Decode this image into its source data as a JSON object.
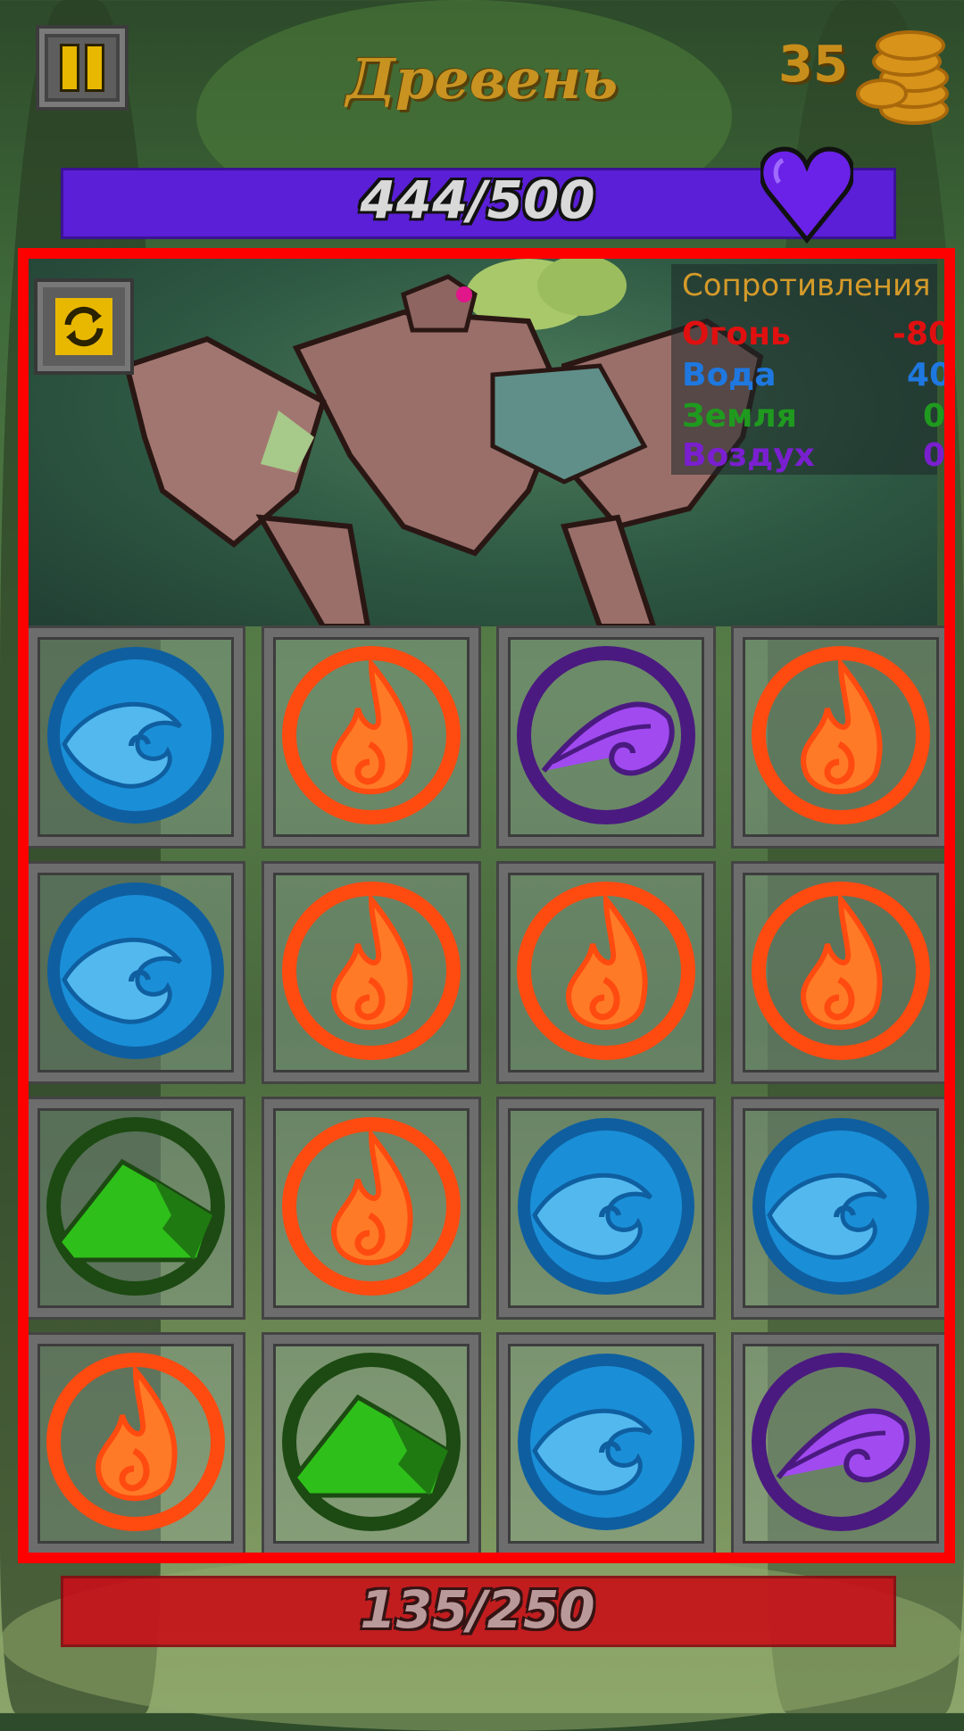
{
  "hud": {
    "boss_name": "Древень",
    "coins": "35",
    "boss_hp": "444/500",
    "player_hp": "135/250",
    "pause_icon": "pause-icon",
    "refresh_icon": "refresh-icon",
    "heart_icon": "heart-icon",
    "coin_icon": "coin-stack-icon"
  },
  "resistances": {
    "title": "Сопротивления",
    "rows": [
      {
        "label": "Огонь",
        "value": "-80",
        "color": "#e01010"
      },
      {
        "label": "Вода",
        "value": "40",
        "color": "#1e78e0"
      },
      {
        "label": "Земля",
        "value": "0",
        "color": "#1f9a1f"
      },
      {
        "label": "Воздух",
        "value": "0",
        "color": "#7a1fd0"
      }
    ]
  },
  "board": {
    "rows": [
      [
        "water",
        "fire",
        "air",
        "fire"
      ],
      [
        "water",
        "fire",
        "fire",
        "fire"
      ],
      [
        "earth",
        "fire",
        "water",
        "water"
      ],
      [
        "fire",
        "earth",
        "water",
        "air"
      ]
    ]
  },
  "colors": {
    "boss_hp": "#5a1fd6",
    "player_hp": "#c80f18",
    "frame": "#ff0000",
    "fire": "#ff4a10",
    "water": "#1a8fd8",
    "earth": "#2fbf1a",
    "air": "#8a3be0"
  }
}
